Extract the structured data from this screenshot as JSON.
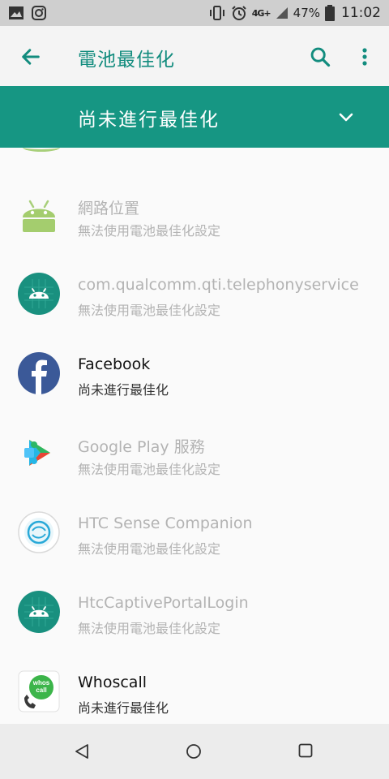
{
  "status_bar": {
    "battery_percent": "47%",
    "time": "11:02",
    "network": "4G+",
    "icons": [
      "gallery-icon",
      "instagram-icon",
      "vibrate-icon",
      "alarm-icon",
      "signal-icon",
      "battery-icon"
    ]
  },
  "app_bar": {
    "title": "電池最佳化",
    "back_icon": "arrow-left-icon",
    "search_icon": "search-icon",
    "more_icon": "more-vert-icon"
  },
  "filter": {
    "label": "尚未進行最佳化",
    "icon": "chevron-down-icon"
  },
  "apps": [
    {
      "name": "網路位置",
      "status": "無法使用電池最佳化設定",
      "enabled": false,
      "icon": "android-green-icon"
    },
    {
      "name": "com.qualcomm.qti.telephonyservice",
      "status": "無法使用電池最佳化設定",
      "enabled": false,
      "icon": "android-teal-icon"
    },
    {
      "name": "Facebook",
      "status": "尚未進行最佳化",
      "enabled": true,
      "icon": "facebook-icon"
    },
    {
      "name": "Google Play 服務",
      "status": "無法使用電池最佳化設定",
      "enabled": false,
      "icon": "google-play-services-icon"
    },
    {
      "name": "HTC Sense Companion",
      "status": "無法使用電池最佳化設定",
      "enabled": false,
      "icon": "htc-sense-companion-icon"
    },
    {
      "name": "HtcCaptivePortalLogin",
      "status": "無法使用電池最佳化設定",
      "enabled": false,
      "icon": "android-teal-icon"
    },
    {
      "name": "Whoscall",
      "status": "尚未進行最佳化",
      "enabled": true,
      "icon": "whoscall-icon",
      "icon_text": "whos call"
    }
  ],
  "colors": {
    "accent": "#128c7e",
    "filter_bar": "#169683",
    "disabled_text": "#b3b3b3",
    "background": "#fafafa"
  }
}
